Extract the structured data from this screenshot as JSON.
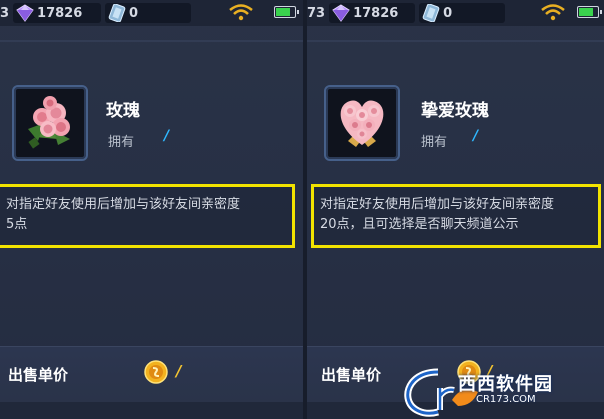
{
  "top_bar": {
    "left": {
      "cut_prefix": "3",
      "gems": "17826",
      "tickets": "0"
    },
    "right": {
      "cut_prefix": "73",
      "gems": "17826",
      "tickets": "0"
    },
    "battery_level": 0.75
  },
  "items": [
    {
      "name": "玫瑰",
      "owned_label": "拥有",
      "owned_value": "/",
      "description_line1": "对指定好友使用后增加与该好友间亲密度",
      "description_line2": "5点",
      "sell_label": "出售单价",
      "sell_value": "/",
      "icon": "rose-bouquet-icon"
    },
    {
      "name": "挚爱玫瑰",
      "owned_label": "拥有",
      "owned_value": "/",
      "description_line1": "对指定好友使用后增加与该好友间亲密度",
      "description_line2": "20点，且可选择是否聊天频道公示",
      "sell_label": "出售单价",
      "sell_value": "/",
      "icon": "heart-rose-bouquet-icon"
    }
  ],
  "watermark": {
    "brand": "西西软件园",
    "url": "CR173.COM",
    "logo_letter": "Cr"
  },
  "colors": {
    "highlight_box": "#f2e300",
    "owned_value": "#2fb7ff",
    "sell_value": "#f4c531",
    "panel_bg": "#273045"
  }
}
